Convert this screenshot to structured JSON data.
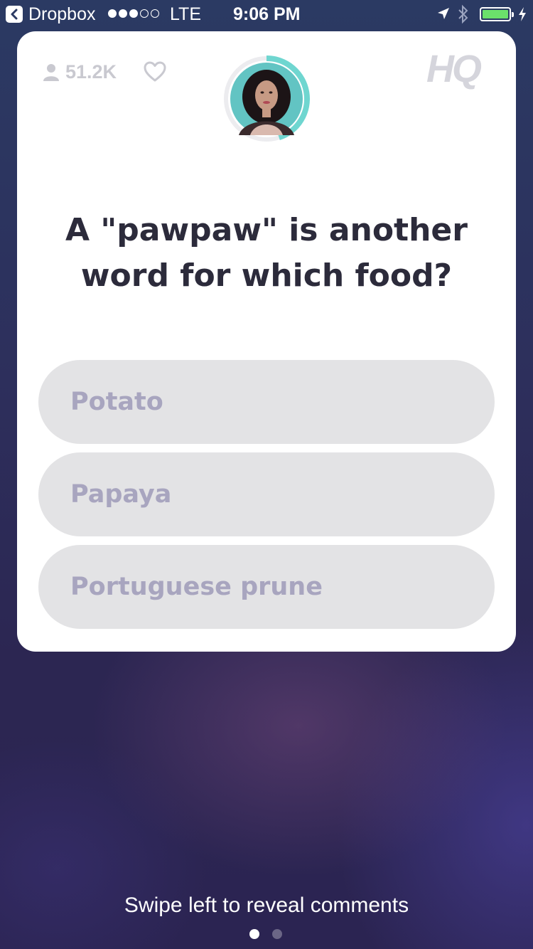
{
  "status_bar": {
    "back_app": "Dropbox",
    "signal_bars_filled": 3,
    "signal_bars_total": 5,
    "network": "LTE",
    "time": "9:06 PM",
    "battery_level": 1.0,
    "battery_color": "#6be06b"
  },
  "header": {
    "viewer_count": "51.2K",
    "logo": "HQ",
    "timer_progress": 0.45,
    "timer_color": "#6fd6d0"
  },
  "question": {
    "text": "A \"pawpaw\" is another word for which food?"
  },
  "answers": [
    {
      "label": "Potato"
    },
    {
      "label": "Papaya"
    },
    {
      "label": "Portuguese prune"
    }
  ],
  "footer": {
    "swipe_hint": "Swipe left to reveal comments",
    "page_count": 2,
    "active_page": 0
  },
  "colors": {
    "card_background": "#ffffff",
    "answer_background": "#e3e3e5",
    "answer_text": "#a8a5bf",
    "question_text": "#2c2b3b"
  }
}
